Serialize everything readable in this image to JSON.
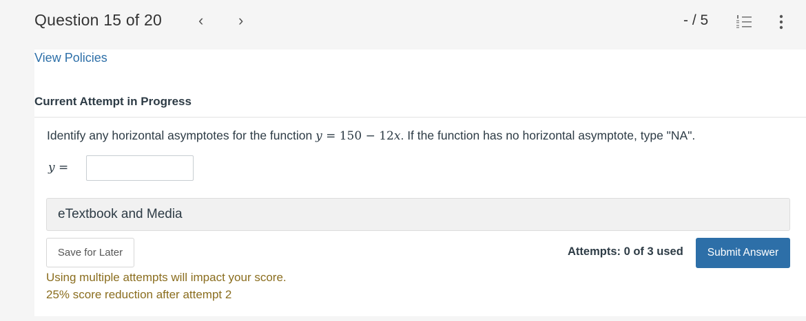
{
  "header": {
    "question_label": "Question 15 of 20",
    "prev_glyph": "‹",
    "next_glyph": "›",
    "score": "- / 5",
    "list_icon": "list-numbered-icon",
    "more_icon": "more-vertical-icon"
  },
  "policies_link": "View Policies",
  "attempt_heading": "Current Attempt in Progress",
  "question": {
    "prefix": "Identify any horizontal asymptotes for the function ",
    "math_y": "y",
    "math_eq": " = 150 − 12",
    "math_x": "x",
    "suffix": ". If the function has no horizontal asymptote, type \"NA\".",
    "answer_label_var": "y",
    "answer_label_eq": " =",
    "answer_value": ""
  },
  "etextbook_label": "eTextbook and Media",
  "buttons": {
    "save_label": "Save for Later",
    "submit_label": "Submit Answer"
  },
  "attempts_text": "Attempts: 0 of 3 used",
  "warnings": {
    "line1": "Using multiple attempts will impact your score.",
    "line2": "25% score reduction after attempt 2"
  },
  "colors": {
    "accent": "#2d6fa8",
    "warning_text": "#8a6d1e"
  }
}
